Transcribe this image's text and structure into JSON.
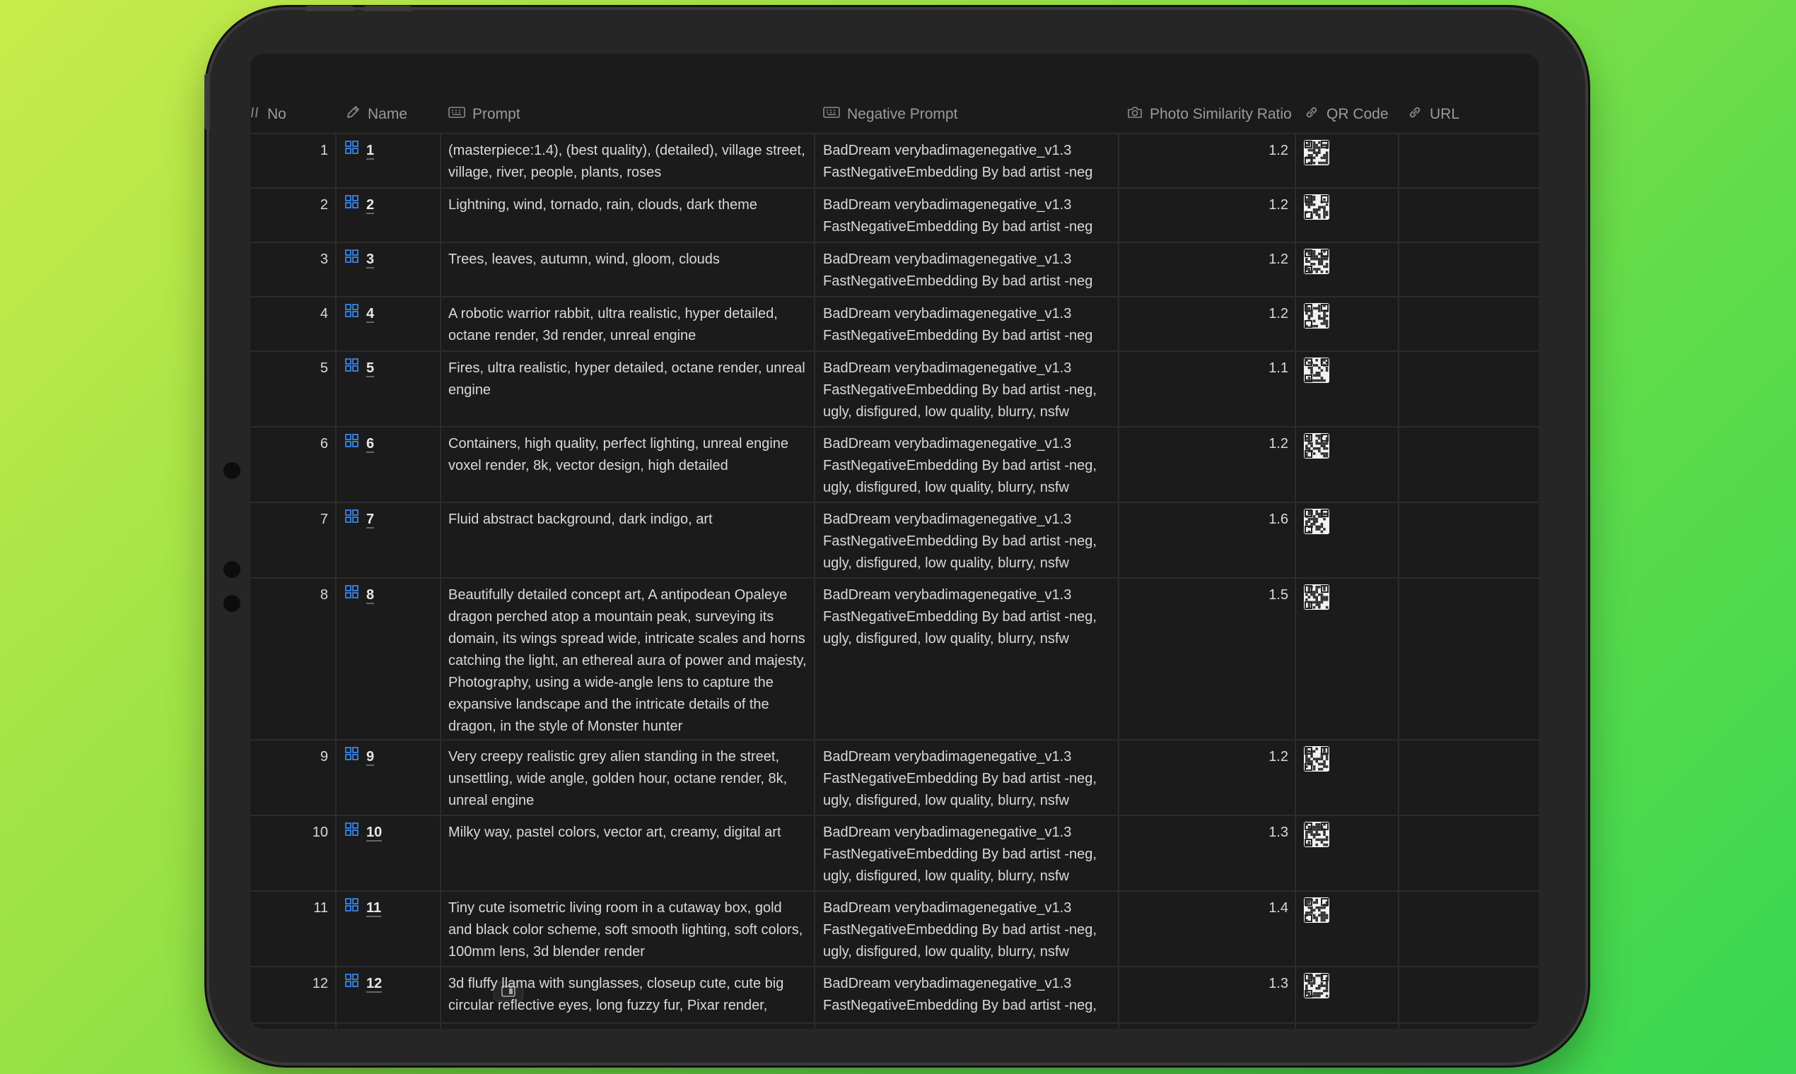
{
  "columns": {
    "no": "No",
    "name": "Name",
    "prompt": "Prompt",
    "negative_prompt": "Negative Prompt",
    "ratio": "Photo Similarity Ratio",
    "qr": "QR Code",
    "url": "URL"
  },
  "rows": [
    {
      "no": "1",
      "name": "1",
      "prompt": "(masterpiece:1.4), (best quality), (detailed), village street, village, river, people, plants, roses",
      "negative": "BadDream verybadimagenegative_v1.3 FastNegativeEmbedding By bad artist -neg",
      "ratio": "1.2"
    },
    {
      "no": "2",
      "name": "2",
      "prompt": "Lightning, wind, tornado, rain, clouds, dark theme",
      "negative": "BadDream verybadimagenegative_v1.3 FastNegativeEmbedding By bad artist -neg",
      "ratio": "1.2"
    },
    {
      "no": "3",
      "name": "3",
      "prompt": "Trees, leaves, autumn, wind, gloom, clouds",
      "negative": "BadDream verybadimagenegative_v1.3 FastNegativeEmbedding By bad artist -neg",
      "ratio": "1.2"
    },
    {
      "no": "4",
      "name": "4",
      "prompt": "A robotic warrior rabbit, ultra realistic, hyper detailed, octane render, 3d render, unreal engine",
      "negative": "BadDream verybadimagenegative_v1.3 FastNegativeEmbedding By bad artist -neg",
      "ratio": "1.2"
    },
    {
      "no": "5",
      "name": "5",
      "prompt": "Fires, ultra realistic, hyper detailed, octane render, unreal engine",
      "negative": "BadDream verybadimagenegative_v1.3 FastNegativeEmbedding By bad artist -neg, ugly, disfigured, low quality, blurry, nsfw",
      "ratio": "1.1"
    },
    {
      "no": "6",
      "name": "6",
      "prompt": "Containers, high quality, perfect lighting, unreal engine voxel render, 8k, vector design, high detailed",
      "negative": "BadDream verybadimagenegative_v1.3 FastNegativeEmbedding By bad artist -neg, ugly, disfigured, low quality, blurry, nsfw",
      "ratio": "1.2"
    },
    {
      "no": "7",
      "name": "7",
      "prompt": "Fluid abstract background, dark indigo, art",
      "negative": "BadDream verybadimagenegative_v1.3 FastNegativeEmbedding By bad artist -neg, ugly, disfigured, low quality, blurry, nsfw",
      "ratio": "1.6"
    },
    {
      "no": "8",
      "name": "8",
      "prompt": "Beautifully detailed concept art, A antipodean Opaleye dragon perched atop a mountain peak, surveying its domain, its wings spread wide, intricate scales and horns catching the light, an ethereal aura of power and majesty, Photography, using a wide-angle lens to capture the expansive landscape and the intricate details of the dragon, in the style of Monster hunter",
      "negative": "BadDream verybadimagenegative_v1.3 FastNegativeEmbedding By bad artist -neg, ugly, disfigured, low quality, blurry, nsfw",
      "ratio": "1.5"
    },
    {
      "no": "9",
      "name": "9",
      "prompt": "Very creepy realistic grey alien standing in the street, unsettling, wide angle, golden hour, octane render, 8k, unreal engine",
      "negative": "BadDream verybadimagenegative_v1.3 FastNegativeEmbedding By bad artist -neg, ugly, disfigured, low quality, blurry, nsfw",
      "ratio": "1.2"
    },
    {
      "no": "10",
      "name": "10",
      "prompt": "Milky way, pastel colors, vector art, creamy, digital art",
      "negative": "BadDream verybadimagenegative_v1.3 FastNegativeEmbedding By bad artist -neg, ugly, disfigured, low quality, blurry, nsfw",
      "ratio": "1.3"
    },
    {
      "no": "11",
      "name": "11",
      "prompt": "Tiny cute isometric living room in a cutaway box, gold and black color scheme, soft smooth lighting, soft colors, 100mm lens, 3d blender render",
      "negative": "BadDream verybadimagenegative_v1.3 FastNegativeEmbedding By bad artist -neg, ugly, disfigured, low quality, blurry, nsfw",
      "ratio": "1.4"
    },
    {
      "no": "12",
      "name": "12",
      "prompt": "3d fluffy llama with sunglasses, closeup cute, cute big circular reflective eyes, long fuzzy fur, Pixar render,",
      "negative": "BadDream verybadimagenegative_v1.3 FastNegativeEmbedding By bad artist -neg,",
      "ratio": "1.3"
    }
  ],
  "colors": {
    "accent": "#3a86e8",
    "background": "#1b1b1b",
    "text": "#d9d9d9",
    "header_text": "#9a9a9a"
  },
  "icons": {
    "no": "hash-icon",
    "name": "pencil-icon",
    "prompt": "keyboard-icon",
    "negative_prompt": "keyboard-icon",
    "ratio": "camera-icon",
    "qr": "link-icon",
    "url": "link-icon",
    "row_name": "grid-icon",
    "open": "open-panel-icon"
  }
}
